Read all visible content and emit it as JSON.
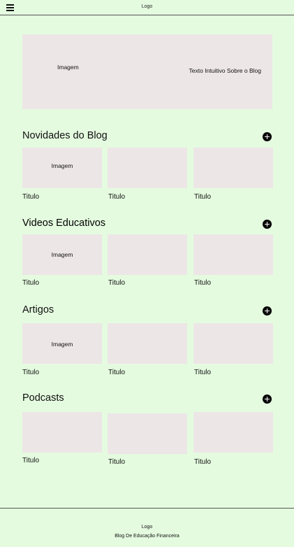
{
  "header": {
    "logo": "Logo",
    "menu_icon": "hamburger-menu-icon"
  },
  "hero": {
    "image_label": "Imagem",
    "text": "Texto Intuitivo Sobre o Blog"
  },
  "sections": [
    {
      "title": "Novidades do Blog",
      "add_icon": "plus-circle-icon",
      "cards": [
        {
          "image_label": "Imagem",
          "title": "Titulo"
        },
        {
          "image_label": "",
          "title": "Titulo"
        },
        {
          "image_label": "",
          "title": "Titulo"
        }
      ]
    },
    {
      "title": "Videos Educativos",
      "add_icon": "plus-circle-icon",
      "cards": [
        {
          "image_label": "Imagem",
          "title": "Titulo"
        },
        {
          "image_label": "",
          "title": "Titulo"
        },
        {
          "image_label": "",
          "title": "Titulo"
        }
      ]
    },
    {
      "title": "Artigos",
      "add_icon": "plus-circle-icon",
      "cards": [
        {
          "image_label": "Imagem",
          "title": "Titulo"
        },
        {
          "image_label": "",
          "title": "Titulo"
        },
        {
          "image_label": "",
          "title": "Titulo"
        }
      ]
    },
    {
      "title": "Podcasts",
      "add_icon": "plus-circle-icon",
      "cards": [
        {
          "image_label": "",
          "title": "Titulo"
        },
        {
          "image_label": "",
          "title": "Titulo"
        },
        {
          "image_label": "",
          "title": "Titulo"
        }
      ]
    }
  ],
  "footer": {
    "logo": "Logo",
    "name": "Blog De Educação Financeira"
  },
  "colors": {
    "background": "#e4fbdf",
    "placeholder": "#ede6e6",
    "text": "#111111"
  }
}
